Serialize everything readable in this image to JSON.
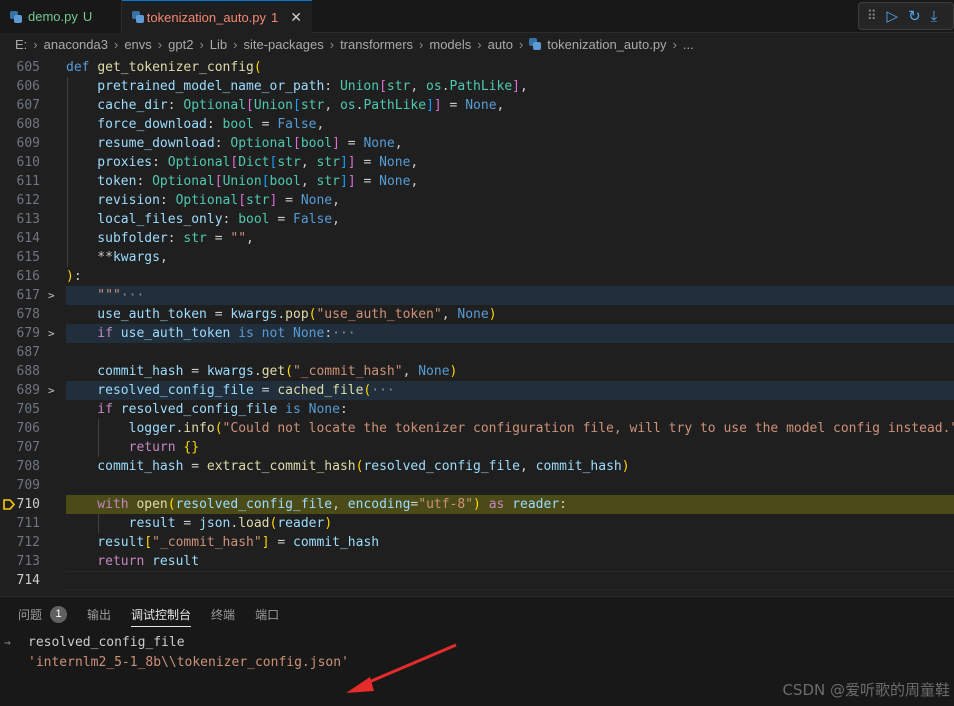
{
  "tabs": [
    {
      "label": "demo.py",
      "badge": "U"
    },
    {
      "label": "tokenization_auto.py",
      "badge": "1",
      "close": "✕"
    }
  ],
  "debug_toolbar": {
    "grip": "⠿",
    "continue": "▷",
    "restart": "↻",
    "step": "⤓"
  },
  "breadcrumb": [
    "E:",
    "anaconda3",
    "envs",
    "gpt2",
    "Lib",
    "site-packages",
    "transformers",
    "models",
    "auto",
    "tokenization_auto.py",
    "..."
  ],
  "editor": {
    "lines": [
      {
        "n": "605",
        "tokens": [
          [
            "k",
            "def "
          ],
          [
            "f",
            "get_tokenizer_config"
          ],
          [
            "br1",
            "("
          ]
        ]
      },
      {
        "n": "606",
        "tokens": [
          [
            "v",
            "    pretrained_model_name_or_path"
          ],
          [
            "p",
            ": "
          ],
          [
            "t",
            "Union"
          ],
          [
            "br2",
            "["
          ],
          [
            "t",
            "str"
          ],
          [
            "p",
            ", "
          ],
          [
            "t",
            "os"
          ],
          [
            "p",
            "."
          ],
          [
            "t",
            "PathLike"
          ],
          [
            "br2",
            "]"
          ],
          [
            "p",
            ","
          ]
        ]
      },
      {
        "n": "607",
        "tokens": [
          [
            "v",
            "    cache_dir"
          ],
          [
            "p",
            ": "
          ],
          [
            "t",
            "Optional"
          ],
          [
            "br2",
            "["
          ],
          [
            "t",
            "Union"
          ],
          [
            "br3",
            "["
          ],
          [
            "t",
            "str"
          ],
          [
            "p",
            ", "
          ],
          [
            "t",
            "os"
          ],
          [
            "p",
            "."
          ],
          [
            "t",
            "PathLike"
          ],
          [
            "br3",
            "]"
          ],
          [
            "br2",
            "]"
          ],
          [
            "p",
            " = "
          ],
          [
            "k",
            "None"
          ],
          [
            "p",
            ","
          ]
        ]
      },
      {
        "n": "608",
        "tokens": [
          [
            "v",
            "    force_download"
          ],
          [
            "p",
            ": "
          ],
          [
            "t",
            "bool"
          ],
          [
            "p",
            " = "
          ],
          [
            "k",
            "False"
          ],
          [
            "p",
            ","
          ]
        ]
      },
      {
        "n": "609",
        "tokens": [
          [
            "v",
            "    resume_download"
          ],
          [
            "p",
            ": "
          ],
          [
            "t",
            "Optional"
          ],
          [
            "br2",
            "["
          ],
          [
            "t",
            "bool"
          ],
          [
            "br2",
            "]"
          ],
          [
            "p",
            " = "
          ],
          [
            "k",
            "None"
          ],
          [
            "p",
            ","
          ]
        ]
      },
      {
        "n": "610",
        "tokens": [
          [
            "v",
            "    proxies"
          ],
          [
            "p",
            ": "
          ],
          [
            "t",
            "Optional"
          ],
          [
            "br2",
            "["
          ],
          [
            "t",
            "Dict"
          ],
          [
            "br3",
            "["
          ],
          [
            "t",
            "str"
          ],
          [
            "p",
            ", "
          ],
          [
            "t",
            "str"
          ],
          [
            "br3",
            "]"
          ],
          [
            "br2",
            "]"
          ],
          [
            "p",
            " = "
          ],
          [
            "k",
            "None"
          ],
          [
            "p",
            ","
          ]
        ]
      },
      {
        "n": "611",
        "tokens": [
          [
            "v",
            "    token"
          ],
          [
            "p",
            ": "
          ],
          [
            "t",
            "Optional"
          ],
          [
            "br2",
            "["
          ],
          [
            "t",
            "Union"
          ],
          [
            "br3",
            "["
          ],
          [
            "t",
            "bool"
          ],
          [
            "p",
            ", "
          ],
          [
            "t",
            "str"
          ],
          [
            "br3",
            "]"
          ],
          [
            "br2",
            "]"
          ],
          [
            "p",
            " = "
          ],
          [
            "k",
            "None"
          ],
          [
            "p",
            ","
          ]
        ]
      },
      {
        "n": "612",
        "tokens": [
          [
            "v",
            "    revision"
          ],
          [
            "p",
            ": "
          ],
          [
            "t",
            "Optional"
          ],
          [
            "br2",
            "["
          ],
          [
            "t",
            "str"
          ],
          [
            "br2",
            "]"
          ],
          [
            "p",
            " = "
          ],
          [
            "k",
            "None"
          ],
          [
            "p",
            ","
          ]
        ]
      },
      {
        "n": "613",
        "tokens": [
          [
            "v",
            "    local_files_only"
          ],
          [
            "p",
            ": "
          ],
          [
            "t",
            "bool"
          ],
          [
            "p",
            " = "
          ],
          [
            "k",
            "False"
          ],
          [
            "p",
            ","
          ]
        ]
      },
      {
        "n": "614",
        "tokens": [
          [
            "v",
            "    subfolder"
          ],
          [
            "p",
            ": "
          ],
          [
            "t",
            "str"
          ],
          [
            "p",
            " = "
          ],
          [
            "s",
            "\"\""
          ],
          [
            "p",
            ","
          ]
        ]
      },
      {
        "n": "615",
        "tokens": [
          [
            "p",
            "    **"
          ],
          [
            "v",
            "kwargs"
          ],
          [
            "p",
            ","
          ]
        ]
      },
      {
        "n": "616",
        "tokens": [
          [
            "br1",
            ")"
          ],
          [
            "p",
            ":"
          ]
        ]
      },
      {
        "n": "617",
        "fold": true,
        "tokens": [
          [
            "s",
            "    \"\"\""
          ],
          [
            "ell",
            "···"
          ]
        ]
      },
      {
        "n": "678",
        "tokens": [
          [
            "v",
            "    use_auth_token"
          ],
          [
            "p",
            " = "
          ],
          [
            "v",
            "kwargs"
          ],
          [
            "p",
            "."
          ],
          [
            "f",
            "pop"
          ],
          [
            "br1",
            "("
          ],
          [
            "s",
            "\"use_auth_token\""
          ],
          [
            "p",
            ", "
          ],
          [
            "k",
            "None"
          ],
          [
            "br1",
            ")"
          ]
        ]
      },
      {
        "n": "679",
        "fold": true,
        "tokens": [
          [
            "kf",
            "    if "
          ],
          [
            "v",
            "use_auth_token"
          ],
          [
            "k",
            " is not "
          ],
          [
            "k",
            "None"
          ],
          [
            "p",
            ":"
          ],
          [
            "ell",
            "···"
          ]
        ]
      },
      {
        "n": "687",
        "tokens": []
      },
      {
        "n": "688",
        "tokens": [
          [
            "v",
            "    commit_hash"
          ],
          [
            "p",
            " = "
          ],
          [
            "v",
            "kwargs"
          ],
          [
            "p",
            "."
          ],
          [
            "f",
            "get"
          ],
          [
            "br1",
            "("
          ],
          [
            "s",
            "\"_commit_hash\""
          ],
          [
            "p",
            ", "
          ],
          [
            "k",
            "None"
          ],
          [
            "br1",
            ")"
          ]
        ]
      },
      {
        "n": "689",
        "fold": true,
        "tokens": [
          [
            "v",
            "    resolved_config_file"
          ],
          [
            "p",
            " = "
          ],
          [
            "f",
            "cached_file"
          ],
          [
            "br1",
            "("
          ],
          [
            "ell",
            "···"
          ]
        ]
      },
      {
        "n": "705",
        "tokens": [
          [
            "kf",
            "    if "
          ],
          [
            "v",
            "resolved_config_file"
          ],
          [
            "k",
            " is "
          ],
          [
            "k",
            "None"
          ],
          [
            "p",
            ":"
          ]
        ]
      },
      {
        "n": "706",
        "tokens": [
          [
            "v",
            "        logger"
          ],
          [
            "p",
            "."
          ],
          [
            "f",
            "info"
          ],
          [
            "br1",
            "("
          ],
          [
            "s",
            "\"Could not locate the tokenizer configuration file, will try to use the model config instead.\""
          ],
          [
            "br1",
            ")"
          ]
        ]
      },
      {
        "n": "707",
        "tokens": [
          [
            "kf",
            "        return "
          ],
          [
            "br1",
            "{}"
          ]
        ]
      },
      {
        "n": "708",
        "tokens": [
          [
            "v",
            "    commit_hash"
          ],
          [
            "p",
            " = "
          ],
          [
            "f",
            "extract_commit_hash"
          ],
          [
            "br1",
            "("
          ],
          [
            "v",
            "resolved_config_file"
          ],
          [
            "p",
            ", "
          ],
          [
            "v",
            "commit_hash"
          ],
          [
            "br1",
            ")"
          ]
        ]
      },
      {
        "n": "709",
        "tokens": []
      },
      {
        "n": "710",
        "current": true,
        "tokens": [
          [
            "kf",
            "    with "
          ],
          [
            "f",
            "open"
          ],
          [
            "br1",
            "("
          ],
          [
            "v",
            "resolved_config_file"
          ],
          [
            "p",
            ", "
          ],
          [
            "v",
            "encoding"
          ],
          [
            "p",
            "="
          ],
          [
            "s",
            "\"utf-8\""
          ],
          [
            "br1",
            ")"
          ],
          [
            "kf",
            " as "
          ],
          [
            "v",
            "reader"
          ],
          [
            "p",
            ":"
          ]
        ]
      },
      {
        "n": "711",
        "tokens": [
          [
            "v",
            "        result"
          ],
          [
            "p",
            " = "
          ],
          [
            "v",
            "json"
          ],
          [
            "p",
            "."
          ],
          [
            "f",
            "load"
          ],
          [
            "br1",
            "("
          ],
          [
            "v",
            "reader"
          ],
          [
            "br1",
            ")"
          ]
        ]
      },
      {
        "n": "712",
        "tokens": [
          [
            "v",
            "    result"
          ],
          [
            "br1",
            "["
          ],
          [
            "s",
            "\"_commit_hash\""
          ],
          [
            "br1",
            "]"
          ],
          [
            "p",
            " = "
          ],
          [
            "v",
            "commit_hash"
          ]
        ]
      },
      {
        "n": "713",
        "tokens": [
          [
            "kf",
            "    return "
          ],
          [
            "v",
            "result"
          ]
        ]
      },
      {
        "n": "714",
        "cursor": true,
        "tokens": []
      }
    ]
  },
  "panel": {
    "tabs": [
      {
        "label": "问题",
        "badge": "1"
      },
      {
        "label": "输出"
      },
      {
        "label": "调试控制台",
        "active": true
      },
      {
        "label": "终端"
      },
      {
        "label": "端口"
      }
    ],
    "console": [
      {
        "prompt": "→",
        "text": "resolved_config_file",
        "color": "#cccccc"
      },
      {
        "prompt": "",
        "text": "'internlm2_5-1_8b\\\\tokenizer_config.json'",
        "color": "#ce9178"
      }
    ],
    "watermark": "CSDN @爱听歌的周童鞋"
  }
}
